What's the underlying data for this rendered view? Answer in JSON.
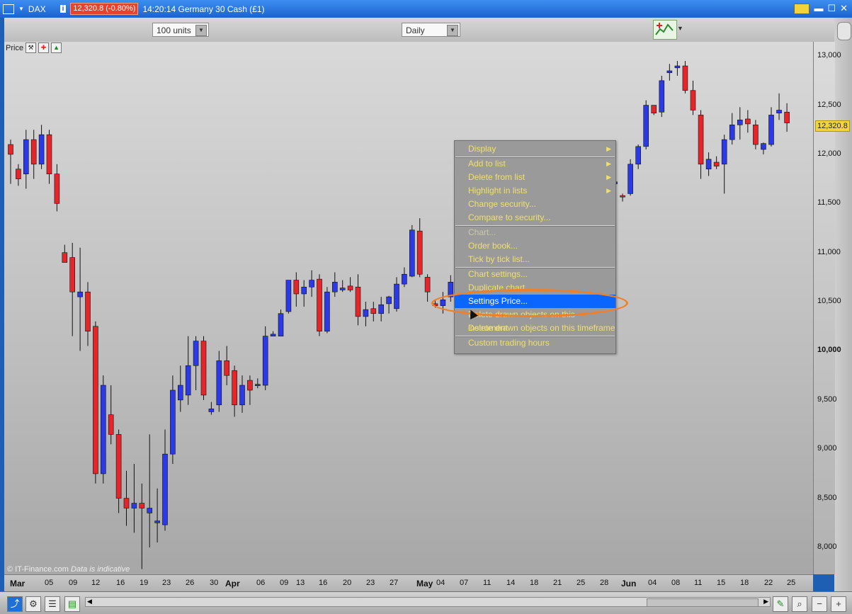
{
  "window": {
    "instrument": "DAX",
    "info_icon": "i",
    "price_change": "12,320.8 (-0.80%)",
    "time_name": "14:20:14 Germany 30 Cash (£1)"
  },
  "toolbar": {
    "units": "100 units",
    "timeframe": "Daily"
  },
  "indicator": {
    "label": "Price"
  },
  "menu": {
    "items": [
      {
        "label": "Display",
        "submenu": true
      },
      {
        "label": "Add to list",
        "submenu": true
      },
      {
        "label": "Delete from list",
        "submenu": true
      },
      {
        "label": "Highlight in lists",
        "submenu": true
      },
      {
        "label": "Change security...",
        "submenu": false
      },
      {
        "label": "Compare to security...",
        "submenu": false
      },
      {
        "label": "Chart...",
        "submenu": false,
        "disabled": true
      },
      {
        "label": "Order book...",
        "submenu": false
      },
      {
        "label": "Tick by tick list...",
        "submenu": false
      },
      {
        "label": "Chart settings...",
        "submenu": false
      },
      {
        "label": "Duplicate chart",
        "submenu": false
      },
      {
        "label": "Settings Price...",
        "submenu": false,
        "selected": true
      },
      {
        "label": "Delete drawn objects on this instrument",
        "submenu": false
      },
      {
        "label": "Delete drawn objects on this timeframe",
        "submenu": false
      },
      {
        "label": "Custom trading hours",
        "submenu": false
      }
    ]
  },
  "footer": {
    "copyright": "© IT-Finance.com",
    "note": "Data is indicative"
  },
  "colors": {
    "up": "#2b39e6",
    "down": "#e4262b",
    "highlight": "#0b66ff",
    "annotation": "#f07f26"
  },
  "chart_data": {
    "type": "candlestick",
    "current_price": "12,320.8",
    "y_ticks": [
      "13,000",
      "12,500",
      "12,000",
      "11,500",
      "11,000",
      "10,500",
      "10,000",
      "9,500",
      "9,000",
      "8,500",
      "8,000"
    ],
    "y_range": [
      7730,
      13320
    ],
    "x_ticks": [
      "Mar",
      "05",
      "09",
      "12",
      "16",
      "19",
      "23",
      "26",
      "30",
      "Apr",
      "06",
      "09",
      "13",
      "16",
      "20",
      "23",
      "27",
      "May",
      "04",
      "07",
      "11",
      "14",
      "18",
      "21",
      "25",
      "28",
      "Jun",
      "04",
      "08",
      "11",
      "15",
      "18",
      "22",
      "25"
    ],
    "candles": [
      {
        "o": 12100,
        "h": 12150,
        "l": 11700,
        "c": 12000
      },
      {
        "o": 11850,
        "h": 11900,
        "l": 11680,
        "c": 11750
      },
      {
        "o": 11800,
        "h": 12250,
        "l": 11650,
        "c": 12150
      },
      {
        "o": 12150,
        "h": 12250,
        "l": 11750,
        "c": 11900
      },
      {
        "o": 11900,
        "h": 12300,
        "l": 11850,
        "c": 12200
      },
      {
        "o": 12200,
        "h": 12250,
        "l": 11700,
        "c": 11800
      },
      {
        "o": 11800,
        "h": 11900,
        "l": 11420,
        "c": 11500
      },
      {
        "o": 11000,
        "h": 11080,
        "l": 10900,
        "c": 10900
      },
      {
        "o": 10950,
        "h": 11100,
        "l": 10150,
        "c": 10600
      },
      {
        "o": 10550,
        "h": 11050,
        "l": 10000,
        "c": 10600
      },
      {
        "o": 10600,
        "h": 10700,
        "l": 10050,
        "c": 10200
      },
      {
        "o": 10250,
        "h": 10300,
        "l": 8650,
        "c": 8750
      },
      {
        "o": 8750,
        "h": 9750,
        "l": 8650,
        "c": 9650
      },
      {
        "o": 9350,
        "h": 9650,
        "l": 9050,
        "c": 9150
      },
      {
        "o": 9150,
        "h": 9200,
        "l": 8350,
        "c": 8500
      },
      {
        "o": 8500,
        "h": 8780,
        "l": 8220,
        "c": 8400
      },
      {
        "o": 8400,
        "h": 8850,
        "l": 8150,
        "c": 8450
      },
      {
        "o": 8450,
        "h": 8650,
        "l": 7780,
        "c": 8400
      },
      {
        "o": 8350,
        "h": 9150,
        "l": 8000,
        "c": 8400
      },
      {
        "o": 8250,
        "h": 8600,
        "l": 8050,
        "c": 8270
      },
      {
        "o": 8230,
        "h": 9200,
        "l": 8170,
        "c": 8950
      },
      {
        "o": 8950,
        "h": 9750,
        "l": 8850,
        "c": 9600
      },
      {
        "o": 9500,
        "h": 9850,
        "l": 9380,
        "c": 9650
      },
      {
        "o": 9550,
        "h": 10150,
        "l": 9450,
        "c": 9850
      },
      {
        "o": 9850,
        "h": 10150,
        "l": 9600,
        "c": 10100
      },
      {
        "o": 10100,
        "h": 10150,
        "l": 9500,
        "c": 9550
      },
      {
        "o": 9380,
        "h": 9480,
        "l": 9350,
        "c": 9410
      },
      {
        "o": 9450,
        "h": 10000,
        "l": 9380,
        "c": 9900
      },
      {
        "o": 9900,
        "h": 10050,
        "l": 9650,
        "c": 9750
      },
      {
        "o": 9800,
        "h": 9850,
        "l": 9330,
        "c": 9450
      },
      {
        "o": 9450,
        "h": 9750,
        "l": 9370,
        "c": 9650
      },
      {
        "o": 9700,
        "h": 9750,
        "l": 9450,
        "c": 9600
      },
      {
        "o": 9650,
        "h": 9720,
        "l": 9620,
        "c": 9660
      },
      {
        "o": 9650,
        "h": 10250,
        "l": 9600,
        "c": 10150
      },
      {
        "o": 10150,
        "h": 10200,
        "l": 10150,
        "c": 10170
      },
      {
        "o": 10150,
        "h": 10420,
        "l": 10150,
        "c": 10380
      },
      {
        "o": 10400,
        "h": 10720,
        "l": 10380,
        "c": 10720
      },
      {
        "o": 10720,
        "h": 10800,
        "l": 10450,
        "c": 10580
      },
      {
        "o": 10580,
        "h": 10720,
        "l": 10450,
        "c": 10650
      },
      {
        "o": 10650,
        "h": 10820,
        "l": 10550,
        "c": 10720
      },
      {
        "o": 10730,
        "h": 10780,
        "l": 10150,
        "c": 10200
      },
      {
        "o": 10200,
        "h": 10650,
        "l": 10180,
        "c": 10600
      },
      {
        "o": 10600,
        "h": 10800,
        "l": 10550,
        "c": 10700
      },
      {
        "o": 10620,
        "h": 10720,
        "l": 10600,
        "c": 10640
      },
      {
        "o": 10660,
        "h": 10750,
        "l": 10600,
        "c": 10620
      },
      {
        "o": 10650,
        "h": 10780,
        "l": 10260,
        "c": 10350
      },
      {
        "o": 10350,
        "h": 10500,
        "l": 10250,
        "c": 10420
      },
      {
        "o": 10430,
        "h": 10500,
        "l": 10300,
        "c": 10380
      },
      {
        "o": 10380,
        "h": 10550,
        "l": 10300,
        "c": 10470
      },
      {
        "o": 10480,
        "h": 10560,
        "l": 10380,
        "c": 10550
      },
      {
        "o": 10430,
        "h": 10750,
        "l": 10400,
        "c": 10680
      },
      {
        "o": 10680,
        "h": 10850,
        "l": 10650,
        "c": 10780
      },
      {
        "o": 10760,
        "h": 11280,
        "l": 10750,
        "c": 11230
      },
      {
        "o": 11220,
        "h": 11350,
        "l": 10750,
        "c": 10780
      },
      {
        "o": 10750,
        "h": 10780,
        "l": 10500,
        "c": 10600
      },
      {
        "o": 10480,
        "h": 10520,
        "l": 10440,
        "c": 10460
      },
      {
        "o": 10460,
        "h": 10600,
        "l": 10380,
        "c": 10520
      },
      {
        "o": 10550,
        "h": 10770,
        "l": 10500,
        "c": 10700
      }
    ],
    "candles_right": [
      {
        "o": 11700,
        "h": 11780,
        "l": 11680,
        "c": 11720
      },
      {
        "o": 11580,
        "h": 11600,
        "l": 11520,
        "c": 11570
      },
      {
        "o": 11600,
        "h": 11950,
        "l": 11580,
        "c": 11900
      },
      {
        "o": 11900,
        "h": 12100,
        "l": 11850,
        "c": 12080
      },
      {
        "o": 12080,
        "h": 12550,
        "l": 12050,
        "c": 12500
      },
      {
        "o": 12500,
        "h": 12500,
        "l": 12400,
        "c": 12420
      },
      {
        "o": 12430,
        "h": 12800,
        "l": 12380,
        "c": 12750
      },
      {
        "o": 12830,
        "h": 12920,
        "l": 12750,
        "c": 12850
      },
      {
        "o": 12880,
        "h": 12950,
        "l": 12800,
        "c": 12900
      },
      {
        "o": 12900,
        "h": 12950,
        "l": 12620,
        "c": 12650
      },
      {
        "o": 12650,
        "h": 12750,
        "l": 12400,
        "c": 12450
      },
      {
        "o": 12400,
        "h": 12450,
        "l": 11750,
        "c": 11900
      },
      {
        "o": 11850,
        "h": 12020,
        "l": 11780,
        "c": 11950
      },
      {
        "o": 11920,
        "h": 11980,
        "l": 11850,
        "c": 11880
      },
      {
        "o": 11900,
        "h": 12200,
        "l": 11600,
        "c": 12150
      },
      {
        "o": 12150,
        "h": 12420,
        "l": 12100,
        "c": 12300
      },
      {
        "o": 12300,
        "h": 12480,
        "l": 12150,
        "c": 12350
      },
      {
        "o": 12360,
        "h": 12450,
        "l": 12220,
        "c": 12310
      },
      {
        "o": 12300,
        "h": 12350,
        "l": 12050,
        "c": 12100
      },
      {
        "o": 12050,
        "h": 12120,
        "l": 12000,
        "c": 12110
      },
      {
        "o": 12100,
        "h": 12480,
        "l": 12080,
        "c": 12400
      },
      {
        "o": 12420,
        "h": 12620,
        "l": 12350,
        "c": 12450
      },
      {
        "o": 12430,
        "h": 12520,
        "l": 12230,
        "c": 12320
      }
    ]
  }
}
